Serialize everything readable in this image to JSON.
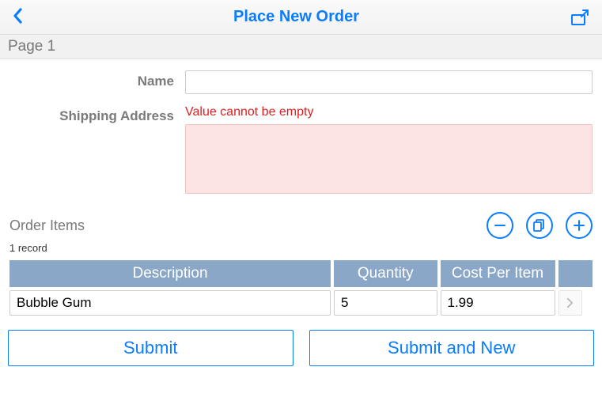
{
  "header": {
    "title": "Place New Order"
  },
  "section": {
    "title": "Page 1"
  },
  "form": {
    "nameLabel": "Name",
    "nameValue": "",
    "shippingLabel": "Shipping Address",
    "shippingError": "Value cannot be empty",
    "shippingValue": ""
  },
  "orderItems": {
    "title": "Order Items",
    "recordCount": "1 record",
    "columns": {
      "description": "Description",
      "quantity": "Quantity",
      "cost": "Cost Per Item"
    },
    "rows": [
      {
        "description": "Bubble Gum",
        "quantity": "5",
        "cost": "1.99"
      }
    ]
  },
  "buttons": {
    "submit": "Submit",
    "submitNew": "Submit and New"
  }
}
